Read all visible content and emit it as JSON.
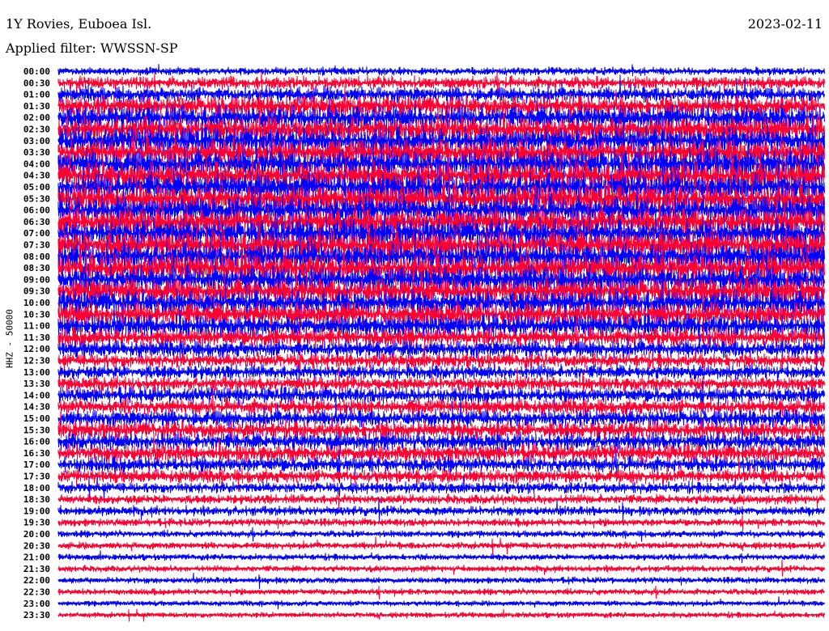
{
  "header": {
    "station": "1Y Rovies, Euboea Isl.",
    "filter": "Applied filter: WWSSN-SP",
    "date": "2023-02-11"
  },
  "chart_data": {
    "type": "line",
    "title": "1Y Rovies, Euboea Isl.",
    "ylabel": "HHZ - 50000",
    "colors": [
      "#0000ff",
      "#ff0033"
    ],
    "rows": [
      "00:00",
      "00:30",
      "01:00",
      "01:30",
      "02:00",
      "02:30",
      "03:00",
      "03:30",
      "04:00",
      "04:30",
      "05:00",
      "05:30",
      "06:00",
      "06:30",
      "07:00",
      "07:30",
      "08:00",
      "08:30",
      "09:00",
      "09:30",
      "10:00",
      "10:30",
      "11:00",
      "11:30",
      "12:00",
      "12:30",
      "13:00",
      "13:30",
      "14:00",
      "14:30",
      "15:00",
      "15:30",
      "16:00",
      "16:30",
      "17:00",
      "17:30",
      "18:00",
      "18:30",
      "19:00",
      "19:30",
      "20:00",
      "20:30",
      "21:00",
      "21:30",
      "22:00",
      "22:30",
      "23:00",
      "23:30"
    ],
    "relative_amplitude": [
      0.5,
      0.8,
      1.0,
      1.3,
      1.5,
      1.6,
      1.7,
      1.7,
      1.8,
      1.8,
      1.8,
      1.8,
      1.8,
      1.8,
      1.8,
      1.8,
      1.8,
      1.8,
      1.7,
      1.7,
      1.6,
      1.5,
      1.4,
      1.2,
      1.1,
      0.9,
      0.9,
      0.9,
      1.0,
      1.0,
      1.1,
      1.1,
      1.1,
      1.1,
      1.0,
      0.9,
      0.7,
      0.6,
      0.6,
      0.5,
      0.45,
      0.45,
      0.4,
      0.4,
      0.4,
      0.4,
      0.35,
      0.35
    ]
  }
}
